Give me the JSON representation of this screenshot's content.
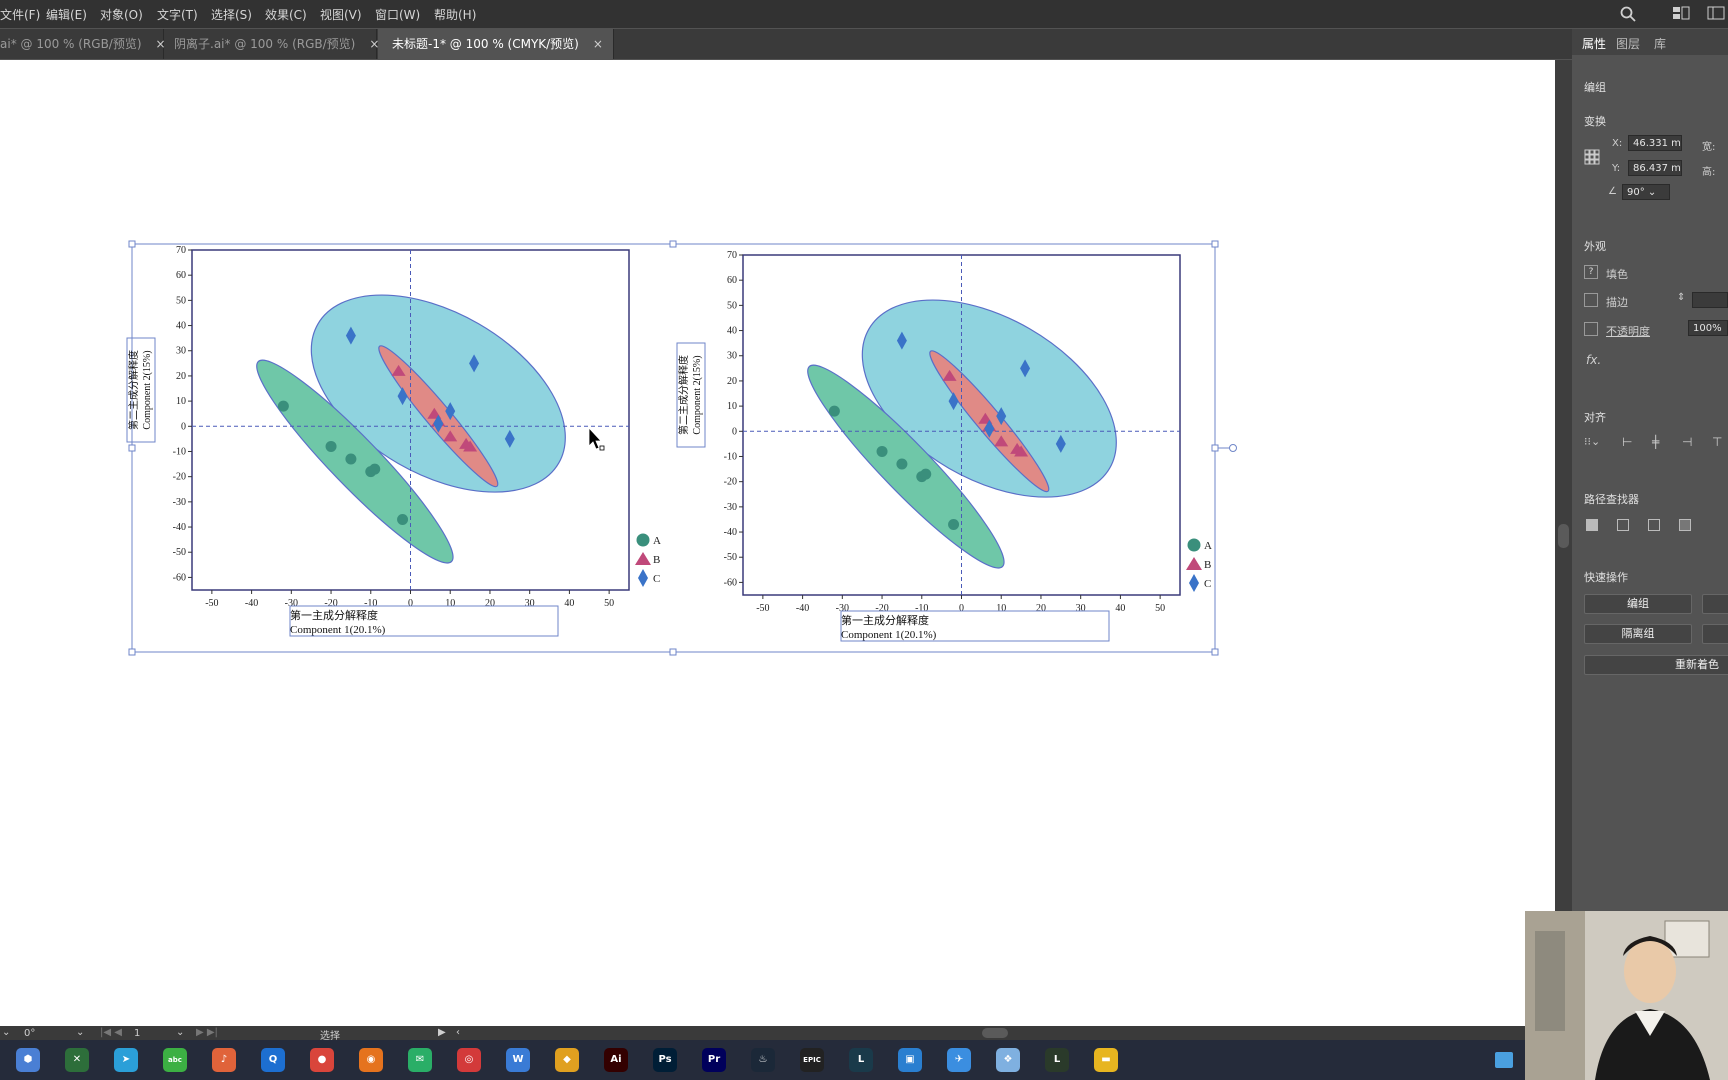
{
  "menubar": {
    "items": [
      "文件(F)",
      "编辑(E)",
      "对象(O)",
      "文字(T)",
      "选择(S)",
      "效果(C)",
      "视图(V)",
      "窗口(W)",
      "帮助(H)"
    ]
  },
  "tabs": [
    {
      "label": "ai* @ 100 % (RGB/预览)",
      "close": "×"
    },
    {
      "label": "阴离子.ai* @ 100 % (RGB/预览)",
      "close": "×"
    },
    {
      "label": "未标题-1* @ 100 % (CMYK/预览)",
      "close": "×"
    }
  ],
  "panel": {
    "tabs": [
      "属性",
      "图层",
      "库"
    ],
    "group_label": "编组",
    "transform_label": "变换",
    "x_label": "X:",
    "x_value": "46.331 m",
    "y_label": "Y:",
    "y_value": "86.437 m",
    "w_label": "宽:",
    "h_label": "高:",
    "angle_value": "90°",
    "appearance_label": "外观",
    "fill_label": "填色",
    "stroke_label": "描边",
    "opacity_label": "不透明度",
    "opacity_value": "100%",
    "fx_label": "fx.",
    "align_label": "对齐",
    "pathfinder_label": "路径查找器",
    "quick_actions_label": "快速操作",
    "group_button": "编组",
    "isolate_button": "隔离组",
    "recolor_button": "重新着色"
  },
  "status": {
    "angle": "0°",
    "page": "1",
    "tool": "选择"
  },
  "taskbar": {
    "icons": [
      {
        "name": "app-baidu-icon",
        "glyph": "⬢",
        "color": "#4a7fd4"
      },
      {
        "name": "app-xbox-icon",
        "glyph": "✕",
        "color": "#2d6e3a"
      },
      {
        "name": "app-telegram-icon",
        "glyph": "➤",
        "color": "#2b9fd8"
      },
      {
        "name": "app-abc-icon",
        "glyph": "abc",
        "color": "#3cb043"
      },
      {
        "name": "app-music-icon",
        "glyph": "♪",
        "color": "#e0633a"
      },
      {
        "name": "app-browser-q-icon",
        "glyph": "Q",
        "color": "#1d6fd1"
      },
      {
        "name": "app-chrome-icon",
        "glyph": "●",
        "color": "#d9453b"
      },
      {
        "name": "app-firefox-icon",
        "glyph": "◉",
        "color": "#e5731e"
      },
      {
        "name": "app-wechat-icon",
        "glyph": "✉",
        "color": "#2aae67"
      },
      {
        "name": "app-netease-icon",
        "glyph": "◎",
        "color": "#d33a3a"
      },
      {
        "name": "app-word-icon",
        "glyph": "W",
        "color": "#3a7bd5"
      },
      {
        "name": "app-shield-icon",
        "glyph": "◆",
        "color": "#e0a020"
      },
      {
        "name": "app-illustrator-icon",
        "glyph": "Ai",
        "color": "#330000"
      },
      {
        "name": "app-photoshop-icon",
        "glyph": "Ps",
        "color": "#001e36"
      },
      {
        "name": "app-premiere-icon",
        "glyph": "Pr",
        "color": "#00005b"
      },
      {
        "name": "app-steam-icon",
        "glyph": "♨",
        "color": "#1b2838"
      },
      {
        "name": "app-epic-icon",
        "glyph": "EPIC",
        "color": "#222222"
      },
      {
        "name": "app-league-icon",
        "glyph": "L",
        "color": "#1a3a4a"
      },
      {
        "name": "app-screen-icon",
        "glyph": "▣",
        "color": "#2a7fd0"
      },
      {
        "name": "app-bird-icon",
        "glyph": "✈",
        "color": "#3b8ee0"
      },
      {
        "name": "app-anime-icon",
        "glyph": "❖",
        "color": "#7fb0e0"
      },
      {
        "name": "app-league2-icon",
        "glyph": "L",
        "color": "#2a3a2a"
      },
      {
        "name": "app-folder-icon",
        "glyph": "▬",
        "color": "#e7b520"
      }
    ]
  },
  "chart_data": [
    {
      "type": "scatter",
      "title": "",
      "xlabel": "第一主成分解释度 Component 1(20.1%)",
      "ylabel": "第二主成分解释度 Component 2(15%)",
      "xlim": [
        -55,
        55
      ],
      "ylim": [
        -65,
        70
      ],
      "xticks": [
        -50,
        -40,
        -30,
        -20,
        -10,
        0,
        10,
        20,
        30,
        40,
        50
      ],
      "yticks": [
        70,
        60,
        50,
        40,
        30,
        20,
        10,
        0,
        -10,
        -20,
        -30,
        -40,
        -50,
        -60
      ],
      "series": [
        {
          "name": "A",
          "color": "#3a8f7c",
          "marker": "circle",
          "points": [
            [
              -32,
              8
            ],
            [
              -20,
              -8
            ],
            [
              -15,
              -13
            ],
            [
              -10,
              -18
            ],
            [
              -9,
              -17
            ],
            [
              -2,
              -37
            ]
          ]
        },
        {
          "name": "B",
          "color": "#c0497a",
          "marker": "triangle",
          "points": [
            [
              -3,
              22
            ],
            [
              6,
              5
            ],
            [
              7,
              2
            ],
            [
              10,
              -4
            ],
            [
              14,
              -7
            ],
            [
              15,
              -8
            ]
          ]
        },
        {
          "name": "C",
          "color": "#3a73c8",
          "marker": "diamond",
          "points": [
            [
              -15,
              36
            ],
            [
              -2,
              12
            ],
            [
              7,
              1
            ],
            [
              10,
              6
            ],
            [
              16,
              25
            ],
            [
              25,
              -5
            ]
          ]
        }
      ],
      "ellipses": [
        {
          "series": "C",
          "color": "#8fd3df",
          "cx": 7,
          "cy": 13,
          "rx": 35,
          "ry": 20,
          "angle_deg": -30
        },
        {
          "series": "A",
          "color": "#6fc7a8",
          "cx": -14,
          "cy": -14,
          "rx": 35,
          "ry": 6,
          "angle_deg": -46
        },
        {
          "series": "B",
          "color": "#e08a86",
          "cx": 7,
          "cy": 4,
          "rx": 23,
          "ry": 3,
          "angle_deg": -50
        }
      ],
      "legend": [
        "A",
        "B",
        "C"
      ],
      "grid": false
    },
    {
      "type": "scatter",
      "title": "",
      "xlabel": "第一主成分解释度 Component 1(20.1%)",
      "ylabel": "第二主成分解释度 Component 2(15%)",
      "xlim": [
        -55,
        55
      ],
      "ylim": [
        -65,
        70
      ],
      "xticks": [
        -50,
        -40,
        -30,
        -20,
        -10,
        0,
        10,
        20,
        30,
        40,
        50
      ],
      "yticks": [
        70,
        60,
        50,
        40,
        30,
        20,
        10,
        0,
        -10,
        -20,
        -30,
        -40,
        -50,
        -60
      ],
      "series": [
        {
          "name": "A",
          "color": "#3a8f7c",
          "marker": "circle",
          "points": [
            [
              -32,
              8
            ],
            [
              -20,
              -8
            ],
            [
              -15,
              -13
            ],
            [
              -10,
              -18
            ],
            [
              -9,
              -17
            ],
            [
              -2,
              -37
            ]
          ]
        },
        {
          "name": "B",
          "color": "#c0497a",
          "marker": "triangle",
          "points": [
            [
              -3,
              22
            ],
            [
              6,
              5
            ],
            [
              7,
              2
            ],
            [
              10,
              -4
            ],
            [
              14,
              -7
            ],
            [
              15,
              -8
            ]
          ]
        },
        {
          "name": "C",
          "color": "#3a73c8",
          "marker": "diamond",
          "points": [
            [
              -15,
              36
            ],
            [
              -2,
              12
            ],
            [
              7,
              1
            ],
            [
              10,
              6
            ],
            [
              16,
              25
            ],
            [
              25,
              -5
            ]
          ]
        }
      ],
      "ellipses": [
        {
          "series": "C",
          "color": "#8fd3df",
          "cx": 7,
          "cy": 13,
          "rx": 35,
          "ry": 20,
          "angle_deg": -30
        },
        {
          "series": "A",
          "color": "#6fc7a8",
          "cx": -14,
          "cy": -14,
          "rx": 35,
          "ry": 6,
          "angle_deg": -46
        },
        {
          "series": "B",
          "color": "#e08a86",
          "cx": 7,
          "cy": 4,
          "rx": 23,
          "ry": 3,
          "angle_deg": -50
        }
      ],
      "legend": [
        "A",
        "B",
        "C"
      ],
      "grid": false
    }
  ]
}
